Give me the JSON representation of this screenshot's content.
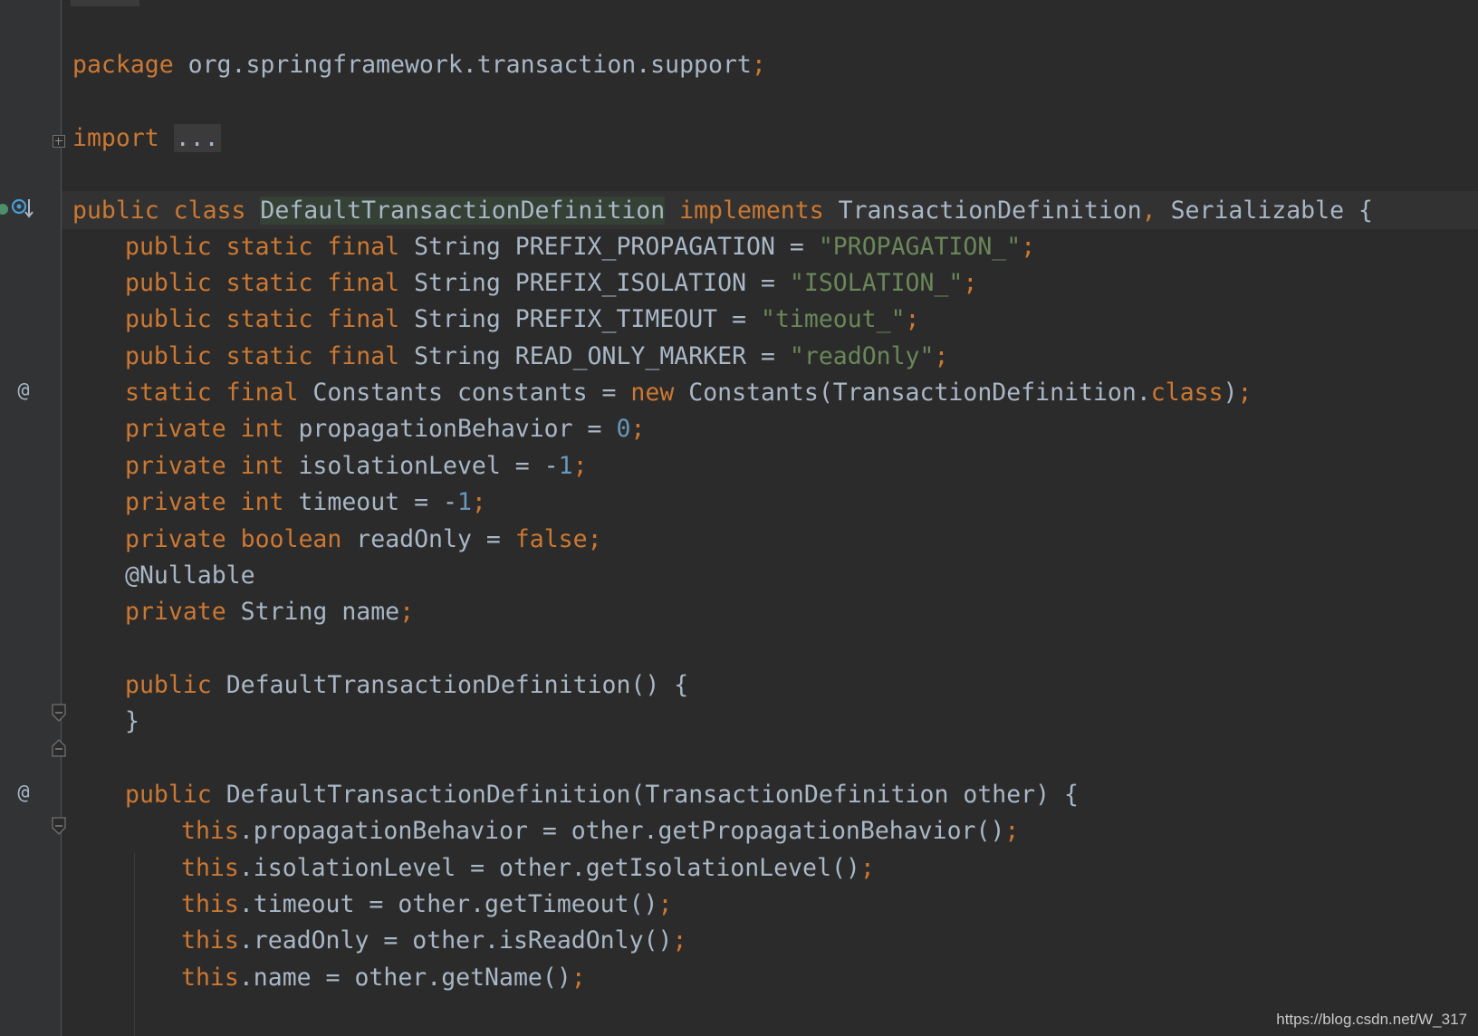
{
  "editor": {
    "theme": "darcula",
    "colors": {
      "background": "#2b2b2b",
      "keyword": "#cc7832",
      "string": "#6a8759",
      "number": "#6897bb",
      "identifier": "#a9b7c6",
      "highlight": "#344134"
    },
    "lines": {
      "l1": {
        "k1": "package",
        "t1": " org.springframework.transaction.support",
        "p1": ";"
      },
      "l2": {
        "k1": "import",
        "t1": " ",
        "dots": "..."
      },
      "l3": {
        "k1": "public class",
        "t1": " ",
        "hl": "DefaultTransactionDefinition",
        "t2": " ",
        "k2": "implements",
        "t3": " TransactionDefinition",
        "p1": ",",
        "t4": " Serializable {"
      },
      "l4": {
        "k1": "public static final",
        "t1": " String PREFIX_PROPAGATION = ",
        "s1": "\"PROPAGATION_\"",
        "p1": ";"
      },
      "l5": {
        "k1": "public static final",
        "t1": " String PREFIX_ISOLATION = ",
        "s1": "\"ISOLATION_\"",
        "p1": ";"
      },
      "l6": {
        "k1": "public static final",
        "t1": " String PREFIX_TIMEOUT = ",
        "s1": "\"timeout_\"",
        "p1": ";"
      },
      "l7": {
        "k1": "public static final",
        "t1": " String READ_ONLY_MARKER = ",
        "s1": "\"readOnly\"",
        "p1": ";"
      },
      "l8": {
        "k1": "static final",
        "t1": " Constants constants = ",
        "k2": "new",
        "t2": " Constants(TransactionDefinition.",
        "k3": "class",
        "t3": ")",
        "p1": ";"
      },
      "l9": {
        "k1": "private int",
        "t1": " propagationBehavior = ",
        "n1": "0",
        "p1": ";"
      },
      "l10": {
        "k1": "private int",
        "t1": " isolationLevel = -",
        "n1": "1",
        "p1": ";"
      },
      "l11": {
        "k1": "private int",
        "t1": " timeout = -",
        "n1": "1",
        "p1": ";"
      },
      "l12": {
        "k1": "private boolean",
        "t1": " readOnly = ",
        "k2": "false",
        "p1": ";"
      },
      "l13": {
        "t1": "@Nullable"
      },
      "l14": {
        "k1": "private",
        "t1": " String name",
        "p1": ";"
      },
      "l15": {
        "k1": "public",
        "t1": " DefaultTransactionDefinition() {"
      },
      "l16": {
        "t1": "}"
      },
      "l17": {
        "k1": "public",
        "t1": " DefaultTransactionDefinition(TransactionDefinition other) {"
      },
      "l18": {
        "k1": "this",
        "t1": ".propagationBehavior = other.getPropagationBehavior()",
        "p1": ";"
      },
      "l19": {
        "k1": "this",
        "t1": ".isolationLevel = other.getIsolationLevel()",
        "p1": ";"
      },
      "l20": {
        "k1": "this",
        "t1": ".timeout = other.getTimeout()",
        "p1": ";"
      },
      "l21": {
        "k1": "this",
        "t1": ".readOnly = other.isReadOnly()",
        "p1": ";"
      },
      "l22": {
        "k1": "this",
        "t1": ".name = other.getName()",
        "p1": ";"
      }
    }
  },
  "gutter": {
    "at_symbol": "@",
    "icons": [
      "implemented-icon",
      "fold-plus-icon",
      "fold-start-icon",
      "fold-end-icon",
      "override-at-icon"
    ]
  },
  "watermark": "https://blog.csdn.net/W_317"
}
